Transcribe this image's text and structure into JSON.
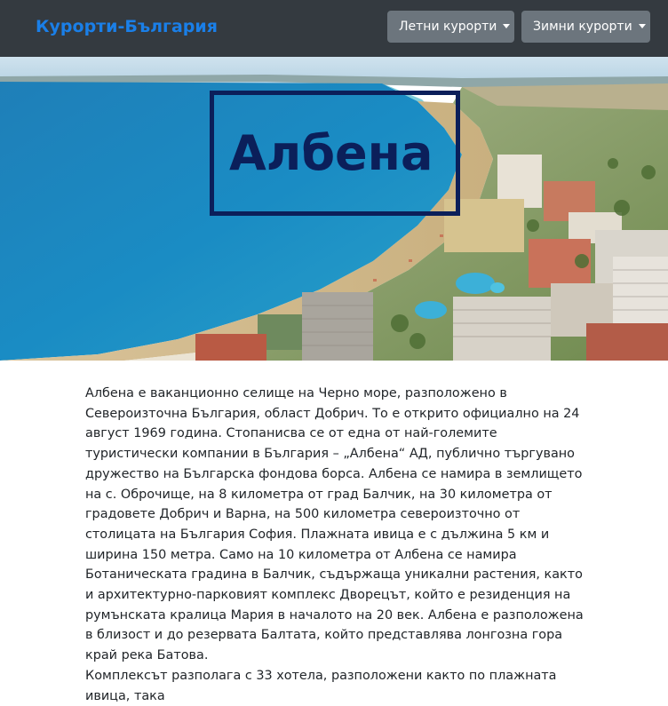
{
  "navbar": {
    "brand": "Курорти-България",
    "dropdowns": [
      {
        "label": "Летни курорти"
      },
      {
        "label": "Зимни курорти"
      }
    ]
  },
  "hero": {
    "title": "Албена",
    "image_description_icon": "resort-beach-photo"
  },
  "content": {
    "paragraphs": [
      "Албена е ваканционно селище на Черно море, разположено в Североизточна България, област Добрич. То е открито официално на 24 август 1969 година. Стопанисва се от една от най-големите туристически компании в България – „Албена“ АД, публично търгувано дружество на Българска фондова борса. Албена се намира в землището на с. Оброчище, на 8 километра от град Балчик, на 30 километра от градовете Добрич и Варна, на 500 километра североизточно от столицата на България София. Плажната ивица е с дължина 5 км и ширина 150 метра. Само на 10 километра от Албена се намира Ботаническата градина в Балчик, съдържаща уникални растения, както и архитектурно-парковият комплекс Дворецът, който е резиденция на румънската кралица Мария в началото на 20 век. Албена е разположена в близост и до резервата Балтата, който представлява лонгозна гора край река Батова.",
      "Комплексът разполага с 33 хотела, разположени както по плажната ивица, така"
    ]
  },
  "colors": {
    "navbar_bg": "#343a40",
    "brand": "#1a7fe8",
    "button_bg": "#6c757d",
    "hero_title": "#0b1f5a",
    "text": "#212529"
  }
}
